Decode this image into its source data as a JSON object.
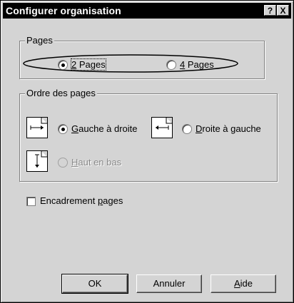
{
  "window": {
    "title": "Configurer organisation"
  },
  "titlebar_buttons": {
    "help": "?",
    "close": "X"
  },
  "pages_group": {
    "legend": "Pages",
    "options": [
      {
        "mnemonic": "2",
        "rest": " Pages",
        "checked": true
      },
      {
        "mnemonic": "4",
        "rest": " Pages",
        "checked": false
      }
    ]
  },
  "order_group": {
    "legend": "Ordre des pages",
    "options": [
      {
        "mnemonic": "G",
        "rest": "auche à droite",
        "checked": true,
        "disabled": false
      },
      {
        "mnemonic": "D",
        "rest": "roite à gauche",
        "checked": false,
        "disabled": false
      },
      {
        "mnemonic": "H",
        "rest": "aut en bas",
        "checked": false,
        "disabled": true
      }
    ]
  },
  "frame_checkbox": {
    "prefix": "Encadrement ",
    "mnemonic": "p",
    "rest": "ages",
    "checked": false
  },
  "buttons": {
    "ok": "OK",
    "cancel": "Annuler",
    "help_m": "A",
    "help_rest": "ide"
  }
}
